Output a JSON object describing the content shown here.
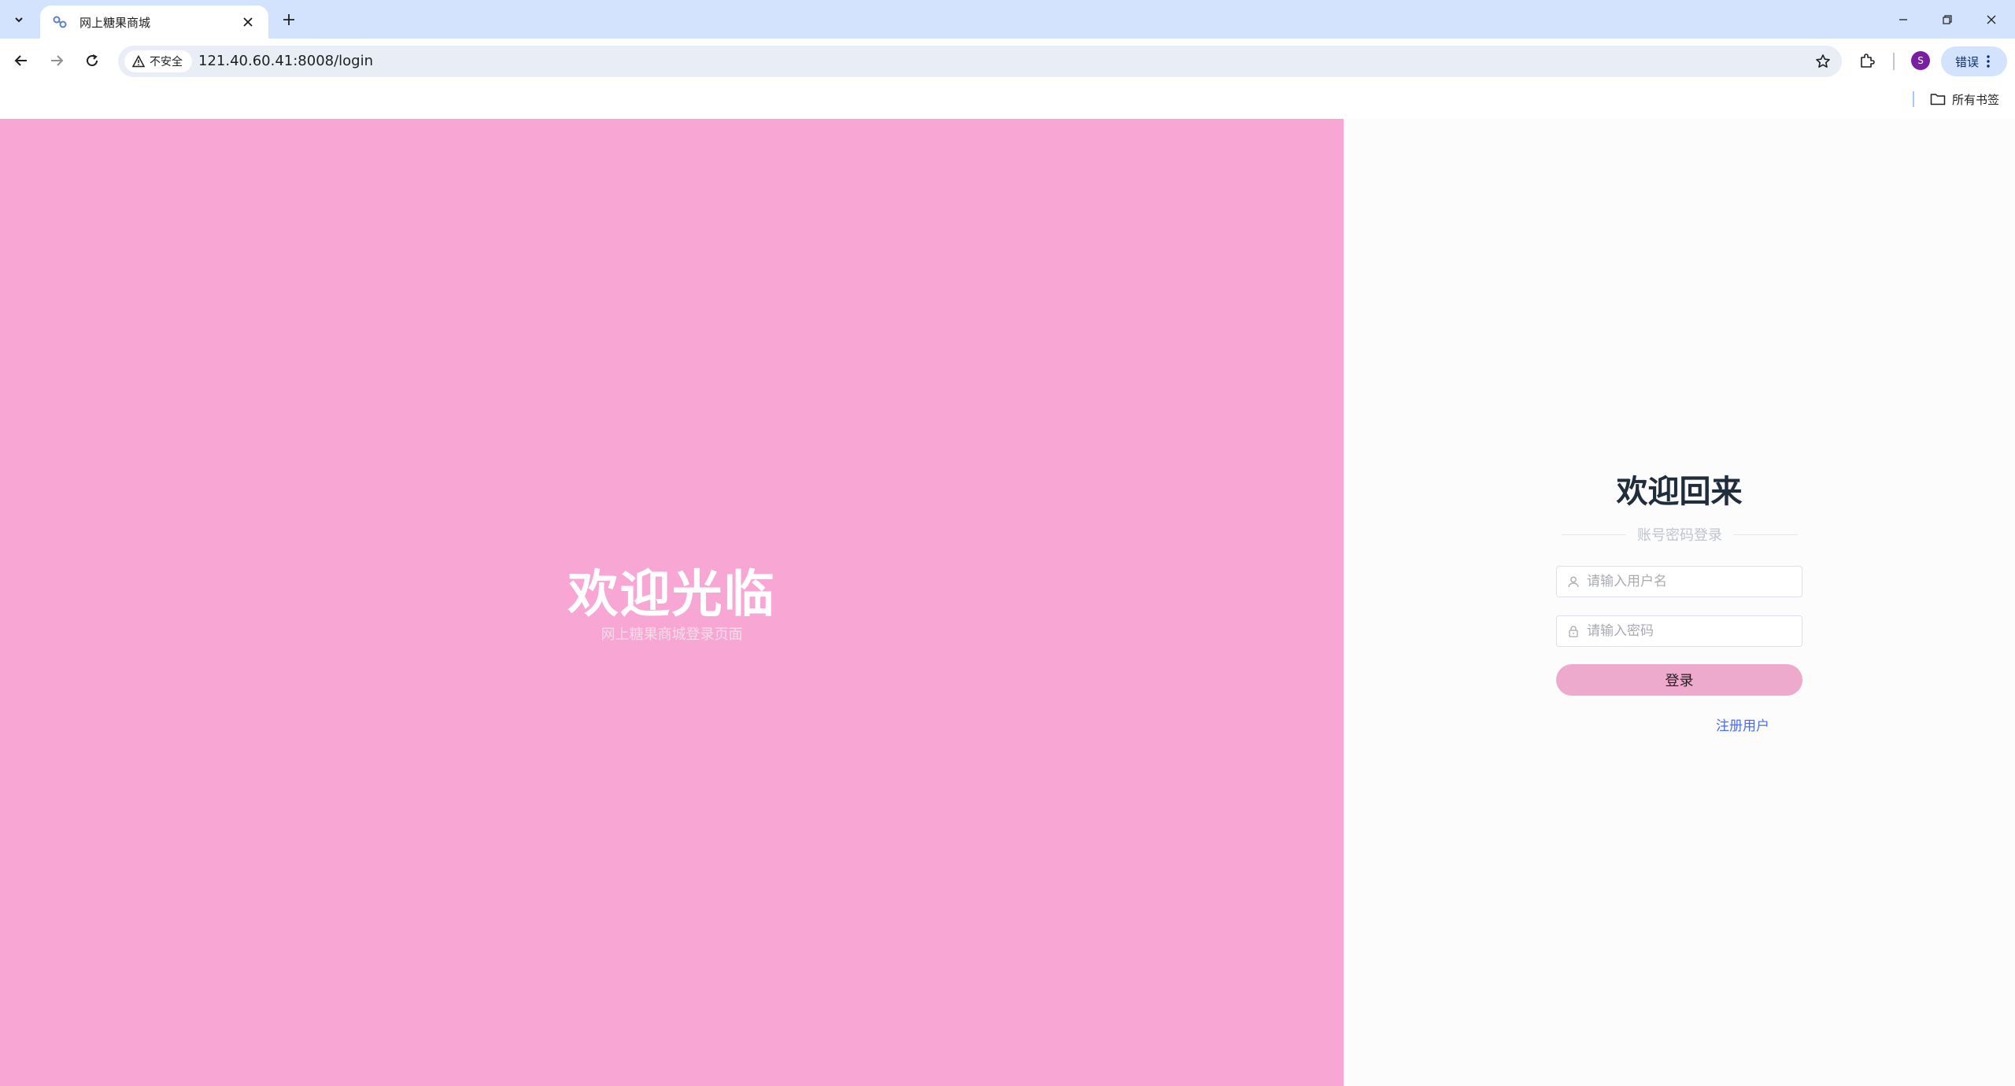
{
  "browser": {
    "tab_title": "网上糖果商城",
    "security_label": "不安全",
    "url": "121.40.60.41:8008/login",
    "profile_initial": "S",
    "error_chip_label": "错误",
    "bookmarks_all_label": "所有书签"
  },
  "hero": {
    "title": "欢迎光临",
    "subtitle": "网上糖果商城登录页面"
  },
  "login": {
    "title": "欢迎回来",
    "divider_text": "账号密码登录",
    "username_placeholder": "请输入用户名",
    "password_placeholder": "请输入密码",
    "submit_label": "登录",
    "register_label": "注册用户"
  },
  "colors": {
    "hero_background": "#f8a7d4",
    "login_button": "#eeaacc",
    "link": "#4a6cf7",
    "tabstrip": "#d3e3fd"
  }
}
